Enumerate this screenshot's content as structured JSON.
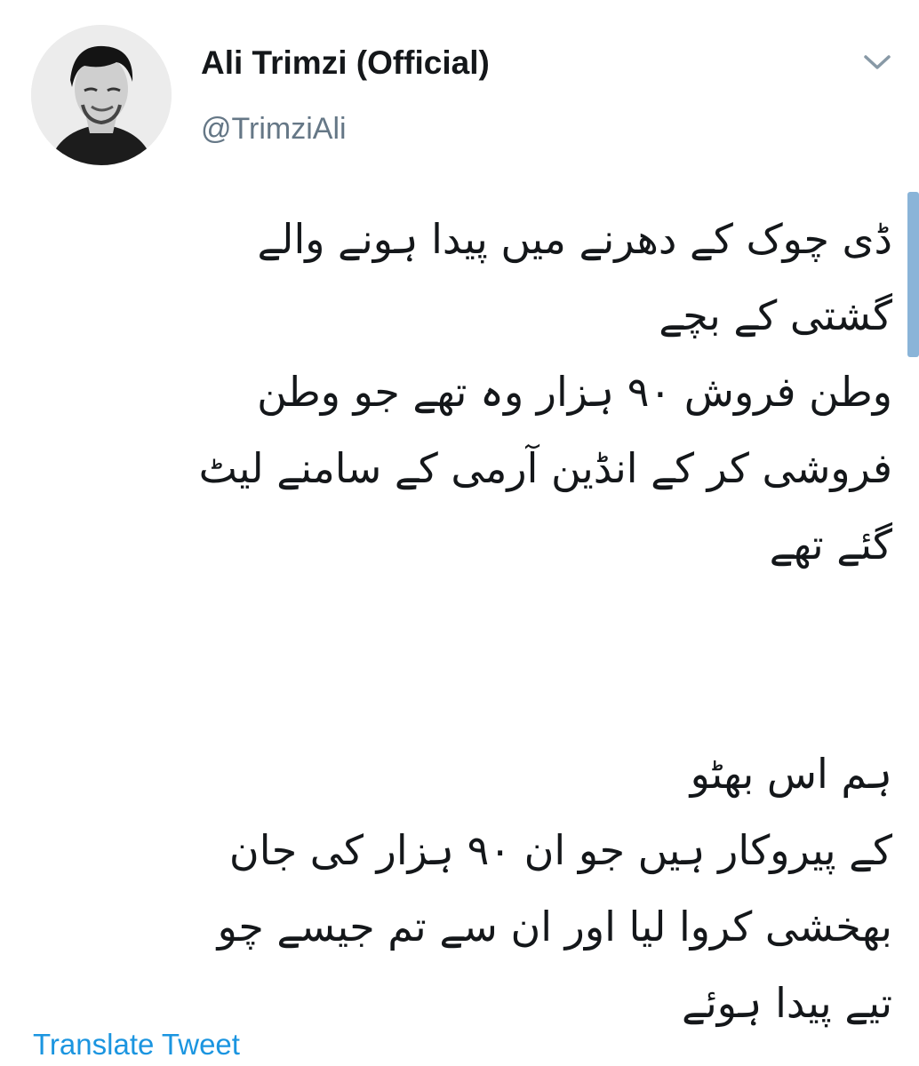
{
  "author": {
    "name": "Ali Trimzi (Official)",
    "handle": "@TrimziAli",
    "avatar_icon": "profile-photo"
  },
  "menu_icon": "chevron-down-icon",
  "tweet": {
    "lines": [
      "ڈی چوک کے دھرنے میں پیدا ہونے والے",
      "گشتی کے بچے",
      "وطن فروش ۹۰ ہزار وہ تھے جو وطن",
      "فروشی کر کے انڈین آرمی کے سامنے لیٹ",
      "گئے تھے",
      "",
      "",
      "ہم اس بھٹو",
      "کے پیروکار ہیں جو ان ۹۰ ہزار کی جان",
      "بھخشی کروا لیا اور ان سے تم جیسے چو",
      "تیے  پیدا ہوئے"
    ]
  },
  "translate_label": "Translate Tweet",
  "colors": {
    "text": "#14171a",
    "secondary": "#657786",
    "link": "#1b95e0",
    "scrollbar": "#8ab4d8"
  }
}
